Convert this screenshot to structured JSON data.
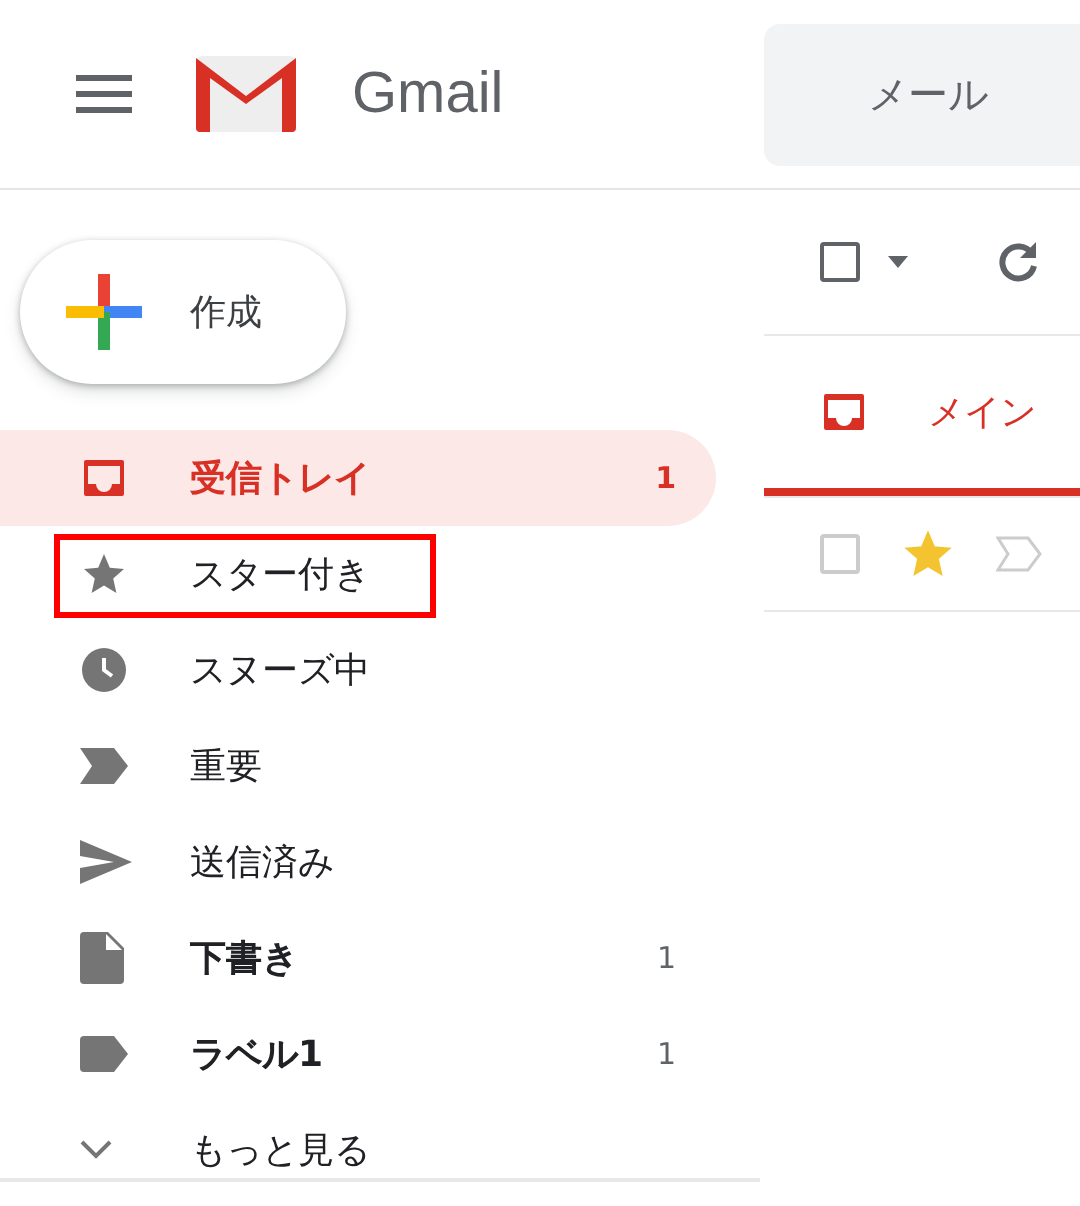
{
  "header": {
    "app_name": "Gmail",
    "search": {
      "placeholder": "メール"
    }
  },
  "compose": {
    "label": "作成"
  },
  "nav": [
    {
      "kind": "inbox",
      "label": "受信トレイ",
      "count": "1",
      "selected": true,
      "bold": true,
      "annotated": false
    },
    {
      "kind": "star",
      "label": "スター付き",
      "selected": false,
      "bold": false,
      "annotated": true
    },
    {
      "kind": "clock",
      "label": "スヌーズ中",
      "selected": false,
      "bold": false,
      "annotated": false
    },
    {
      "kind": "important",
      "label": "重要",
      "selected": false,
      "bold": false,
      "annotated": false
    },
    {
      "kind": "send",
      "label": "送信済み",
      "selected": false,
      "bold": false,
      "annotated": false
    },
    {
      "kind": "draft",
      "label": "下書き",
      "count": "1",
      "selected": false,
      "bold": true,
      "annotated": false
    },
    {
      "kind": "label",
      "label": "ラベル1",
      "count": "1",
      "selected": false,
      "bold": true,
      "annotated": false
    },
    {
      "kind": "more",
      "label": "もっと見る",
      "selected": false,
      "bold": false,
      "annotated": false
    }
  ],
  "toolbar": {
    "select_all_checked": false
  },
  "tabs": [
    {
      "label": "メイン",
      "selected": true
    }
  ],
  "messages": [
    {
      "checked": false,
      "starred": true,
      "important": false
    }
  ]
}
